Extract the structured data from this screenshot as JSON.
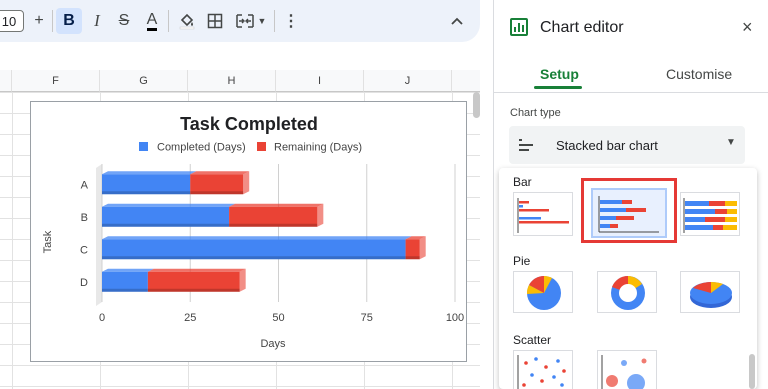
{
  "toolbar": {
    "font_size": "10",
    "plus_icon": "plus-icon",
    "bold_label": "B",
    "italic_label": "I",
    "strike_label": "S",
    "text_color_label": "A",
    "more_label": "⋮",
    "collapse_label": "^"
  },
  "sheet": {
    "columns": [
      "F",
      "G",
      "H",
      "I",
      "J"
    ]
  },
  "chart_data": {
    "type": "bar",
    "orientation": "horizontal",
    "stacked": true,
    "title": "Task Completed",
    "xlabel": "Days",
    "ylabel": "Task",
    "categories": [
      "A",
      "B",
      "C",
      "D"
    ],
    "series": [
      {
        "name": "Completed (Days)",
        "color": "#4285f4",
        "values": [
          25,
          36,
          86,
          13
        ]
      },
      {
        "name": "Remaining (Days)",
        "color": "#ea4335",
        "values": [
          15,
          25,
          4,
          26
        ]
      }
    ],
    "xlim": [
      0,
      100
    ],
    "xticks": [
      "0",
      "25",
      "50",
      "75",
      "100"
    ],
    "legend_position": "top",
    "grid": true,
    "style": "3d"
  },
  "editor": {
    "title": "Chart editor",
    "close_label": "×",
    "tabs": [
      {
        "label": "Setup",
        "selected": true
      },
      {
        "label": "Customise",
        "selected": false
      }
    ],
    "chart_type_label": "Chart type",
    "chart_type_value": "Stacked bar chart",
    "sections": {
      "bar": "Bar",
      "pie": "Pie",
      "scatter": "Scatter"
    },
    "accent": "#188038",
    "highlight_color": "#e53935"
  }
}
